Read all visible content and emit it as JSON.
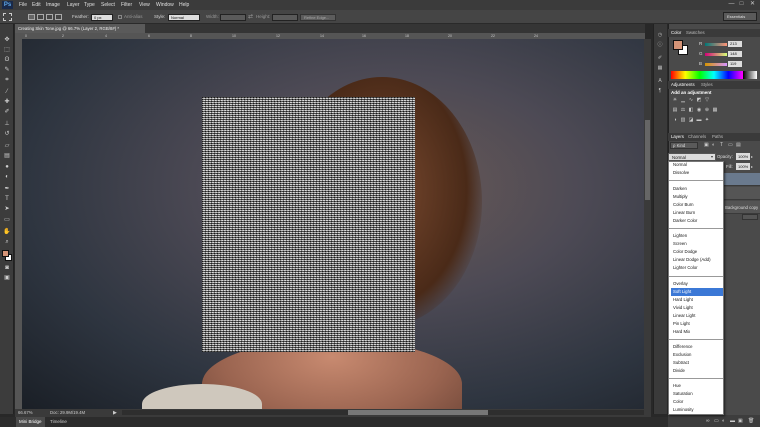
{
  "app": {
    "logo": "Ps",
    "menu": [
      "File",
      "Edit",
      "Image",
      "Layer",
      "Type",
      "Select",
      "Filter",
      "View",
      "Window",
      "Help"
    ],
    "window_controls": [
      "—",
      "□",
      "✕"
    ]
  },
  "options_bar": {
    "feather_label": "Feather:",
    "feather_value": "0 px",
    "anti_alias_label": "Anti-alias",
    "style_label": "Style:",
    "style_value": "Normal",
    "width_label": "Width:",
    "height_label": "Height:",
    "refine_edge_label": "Refine Edge...",
    "workspace": "Essentials"
  },
  "document": {
    "tab_title": "Creating Skin Tone.jpg @ 66.7% (Layer 2, RGB/8#) *",
    "zoom": "66.67%",
    "doc_info": "Doc: 29.9M/19.4M",
    "ruler_ticks": [
      "0",
      "2",
      "4",
      "6",
      "8",
      "10",
      "12",
      "14",
      "16",
      "18",
      "20",
      "22",
      "24"
    ]
  },
  "bottom_tabs": [
    "Mini Bridge",
    "Timeline"
  ],
  "color_panel": {
    "tabs": [
      "Color",
      "Swatches"
    ],
    "channels": [
      {
        "label": "R",
        "value": "213",
        "color": "#e04040"
      },
      {
        "label": "G",
        "value": "148",
        "color": "#40c040"
      },
      {
        "label": "B",
        "value": "119",
        "color": "#4060e0"
      }
    ],
    "foreground": "#d59477",
    "background": "#ffffff"
  },
  "adjustments_panel": {
    "tabs": [
      "Adjustments",
      "Styles"
    ],
    "title": "Add an adjustment"
  },
  "layers_panel": {
    "tabs": [
      "Layers",
      "Channels",
      "Paths"
    ],
    "kind_label": "ρ Kind",
    "opacity_label": "Opacity:",
    "opacity_value": "100%",
    "fill_label": "Fill:",
    "fill_value": "100%",
    "layer_name": "Background copy"
  },
  "blend_select": "Normal",
  "blend_modes": [
    [
      "Normal",
      "Dissolve"
    ],
    [
      "Darken",
      "Multiply",
      "Color Burn",
      "Linear Burn",
      "Darker Color"
    ],
    [
      "Lighten",
      "Screen",
      "Color Dodge",
      "Linear Dodge (Add)",
      "Lighter Color"
    ],
    [
      "Overlay",
      "Soft Light",
      "Hard Light",
      "Vivid Light",
      "Linear Light",
      "Pin Light",
      "Hard Mix"
    ],
    [
      "Difference",
      "Exclusion",
      "Subtract",
      "Divide"
    ],
    [
      "Hue",
      "Saturation",
      "Color",
      "Luminosity"
    ]
  ],
  "selected_blend_mode": "Soft Light",
  "icons": {
    "tools": [
      "move-icon",
      "marquee-icon",
      "lasso-icon",
      "quick-select-icon",
      "crop-icon",
      "eyedropper-icon",
      "healing-icon",
      "brush-icon",
      "clone-stamp-icon",
      "history-brush-icon",
      "eraser-icon",
      "gradient-icon",
      "blur-icon",
      "dodge-icon",
      "pen-icon",
      "type-icon",
      "path-select-icon",
      "shape-icon",
      "hand-icon",
      "zoom-icon"
    ]
  }
}
